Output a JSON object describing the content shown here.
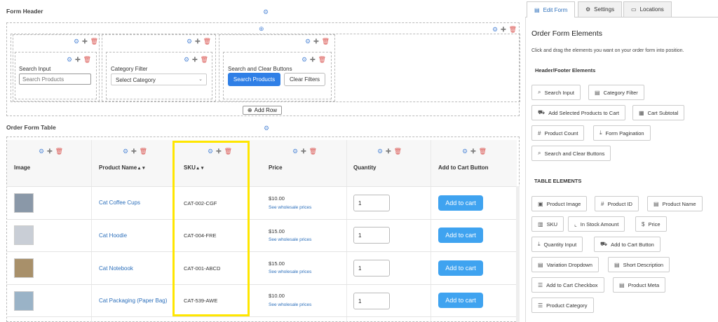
{
  "form_header": {
    "title": "Form Header",
    "add_row": "Add Row",
    "search_input": {
      "label": "Search Input",
      "placeholder": "Search Products"
    },
    "category_filter": {
      "label": "Category Filter",
      "selected": "Select Category"
    },
    "search_clear": {
      "label": "Search and Clear Buttons",
      "search": "Search Products",
      "clear": "Clear Filters"
    }
  },
  "table": {
    "title": "Order Form Table",
    "columns": [
      "Image",
      "Product Name",
      "SKU",
      "Price",
      "Quantity",
      "Add to Cart Button"
    ],
    "sort_glyph": "▲▼",
    "rows": [
      {
        "name": "Cat Coffee Cups",
        "sku": "CAT-002-CGF",
        "price": "$10.00",
        "wholesale": "See wholesale prices",
        "qty": "1",
        "cart": "Add to cart"
      },
      {
        "name": "Cat Hoodie",
        "sku": "CAT-004-FRE",
        "price": "$15.00",
        "wholesale": "See wholesale prices",
        "qty": "1",
        "cart": "Add to cart"
      },
      {
        "name": "Cat Notebook",
        "sku": "CAT-001-ABCD",
        "price": "$15.00",
        "wholesale": "See wholesale prices",
        "qty": "1",
        "cart": "Add to cart"
      },
      {
        "name": "Cat Packaging (Paper Bag)",
        "sku": "CAT-539-AWE",
        "price": "$10.00",
        "wholesale": "See wholesale prices",
        "qty": "1",
        "cart": "Add to cart"
      }
    ]
  },
  "sidebar": {
    "tabs": [
      {
        "label": "Edit Form",
        "icon": "edit-form-icon"
      },
      {
        "label": "Settings",
        "icon": "gear-icon"
      },
      {
        "label": "Locations",
        "icon": "location-icon"
      }
    ],
    "title": "Order Form Elements",
    "description": "Click and drag the elements you want on your order form into position.",
    "header_footer_title": "Header/Footer Elements",
    "header_footer_elements": [
      "Search Input",
      "Category Filter",
      "Add Selected Products to Cart",
      "Cart Subtotal",
      "Product Count",
      "Form Pagination",
      "Search and Clear Buttons"
    ],
    "table_title": "TABLE ELEMENTS",
    "table_elements": [
      "Product Image",
      "Product ID",
      "Product Name",
      "SKU",
      "In Stock Amount",
      "Price",
      "Quantity Input",
      "Add to Cart Button",
      "Variation Dropdown",
      "Short Description",
      "Add to Cart Checkbox",
      "Product Meta",
      "Product Category"
    ]
  },
  "colors": {
    "highlight": "#ffe600",
    "primary": "#2f7fe6",
    "add_to_cart": "#3fa3f0",
    "link": "#2c6fbb"
  }
}
